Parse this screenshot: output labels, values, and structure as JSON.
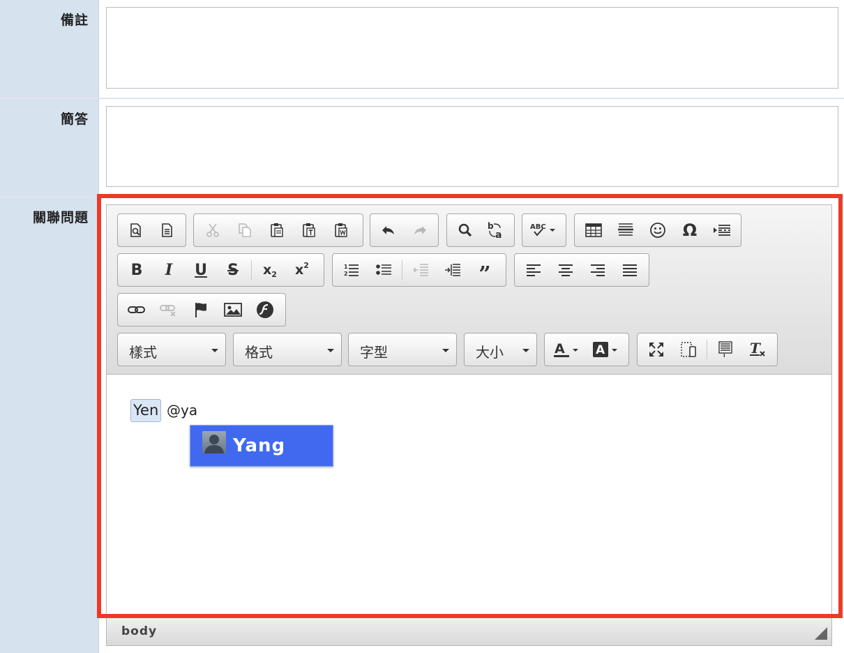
{
  "form": {
    "fields": [
      {
        "label": "備註"
      },
      {
        "label": "簡答"
      },
      {
        "label": "關聯問題"
      }
    ]
  },
  "editor": {
    "toolbar": {
      "row1": [
        [
          "preview-icon",
          "templates-icon"
        ],
        [
          "cut-icon",
          "copy-icon",
          "paste-icon",
          "paste-text-icon",
          "paste-word-icon"
        ],
        [
          "undo-icon",
          "redo-icon"
        ],
        [
          "find-icon",
          "replace-icon"
        ],
        [
          "spellcheck-icon"
        ],
        [
          "table-icon",
          "horizontal-rule-icon",
          "smiley-icon",
          "special-char-icon",
          "page-break-icon"
        ]
      ],
      "row2": [
        [
          "bold-icon",
          "italic-icon",
          "underline-icon",
          "strike-icon",
          "subscript-icon",
          "superscript-icon"
        ],
        [
          "numbered-list-icon",
          "bulleted-list-icon",
          "outdent-icon",
          "indent-icon",
          "blockquote-icon"
        ],
        [
          "align-left-icon",
          "align-center-icon",
          "align-right-icon",
          "justify-icon"
        ]
      ],
      "row3": [
        [
          "link-icon",
          "unlink-icon",
          "anchor-icon",
          "image-icon",
          "flash-icon"
        ]
      ],
      "combos": {
        "styles": "樣式",
        "format": "格式",
        "font": "字型",
        "size": "大小"
      },
      "row4_icons": [
        "text-color-icon",
        "bg-color-icon",
        "maximize-icon",
        "show-blocks-icon",
        "source-icon",
        "remove-format-icon"
      ]
    },
    "content": {
      "mention_chip": "Yen",
      "typed_text": "@ya",
      "suggestion": {
        "name": "Yang",
        "icon": "user-avatar-icon"
      }
    },
    "status_path": "body"
  },
  "colors": {
    "highlight": "#ee3a24",
    "suggestion_bg": "#4069f0",
    "label_bg": "#d7e2ef"
  }
}
